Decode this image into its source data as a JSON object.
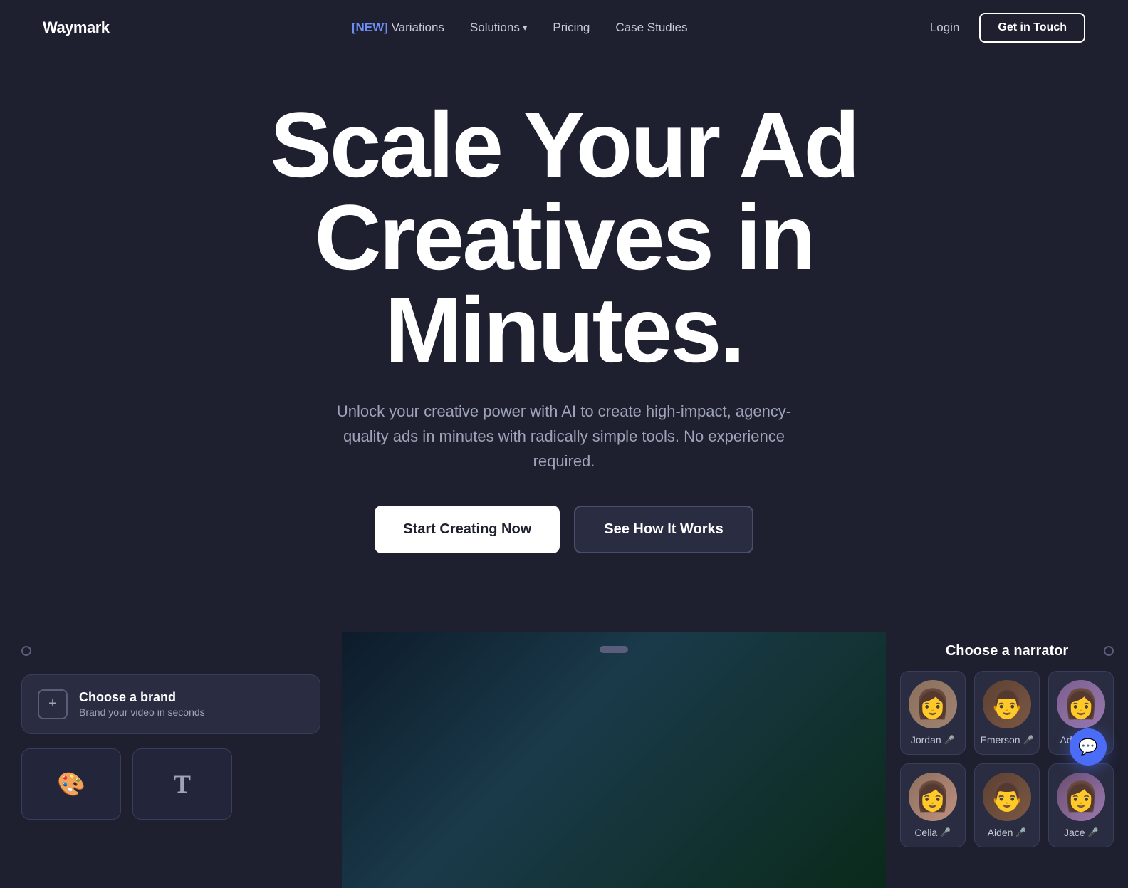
{
  "brand": {
    "name": "Waymark"
  },
  "nav": {
    "logo": "Waymark",
    "new_badge": "[NEW]",
    "links": [
      {
        "id": "variations",
        "label": "Variations",
        "has_badge": true
      },
      {
        "id": "solutions",
        "label": "Solutions",
        "has_dropdown": true
      },
      {
        "id": "pricing",
        "label": "Pricing",
        "has_badge": false
      },
      {
        "id": "case-studies",
        "label": "Case Studies",
        "has_badge": false
      }
    ],
    "right_links": [
      {
        "id": "login",
        "label": "Login"
      }
    ],
    "cta_button": "Get in Touch"
  },
  "hero": {
    "title_line1": "Scale Your Ad",
    "title_line2": "Creatives in",
    "title_line3": "Minutes.",
    "subtitle": "Unlock your creative power with AI to create high-impact, agency-quality ads in minutes with radically simple tools. No experience required.",
    "btn_start": "Start Creating Now",
    "btn_how": "See How It Works"
  },
  "demo": {
    "choose_brand": {
      "heading": "Choose a brand",
      "subtext": "Brand your video in seconds"
    },
    "narrator": {
      "heading": "Choose a narrator",
      "people": [
        {
          "id": "jordan",
          "name": "Jordan",
          "emoji": "👩"
        },
        {
          "id": "emerson",
          "name": "Emerson",
          "emoji": "👨"
        },
        {
          "id": "adrian",
          "name": "Adrian",
          "emoji": "👩"
        },
        {
          "id": "celia",
          "name": "Celia",
          "emoji": "👩"
        },
        {
          "id": "aiden",
          "name": "Aiden",
          "emoji": "👨"
        },
        {
          "id": "jace",
          "name": "Jace",
          "emoji": "👩"
        }
      ]
    }
  }
}
